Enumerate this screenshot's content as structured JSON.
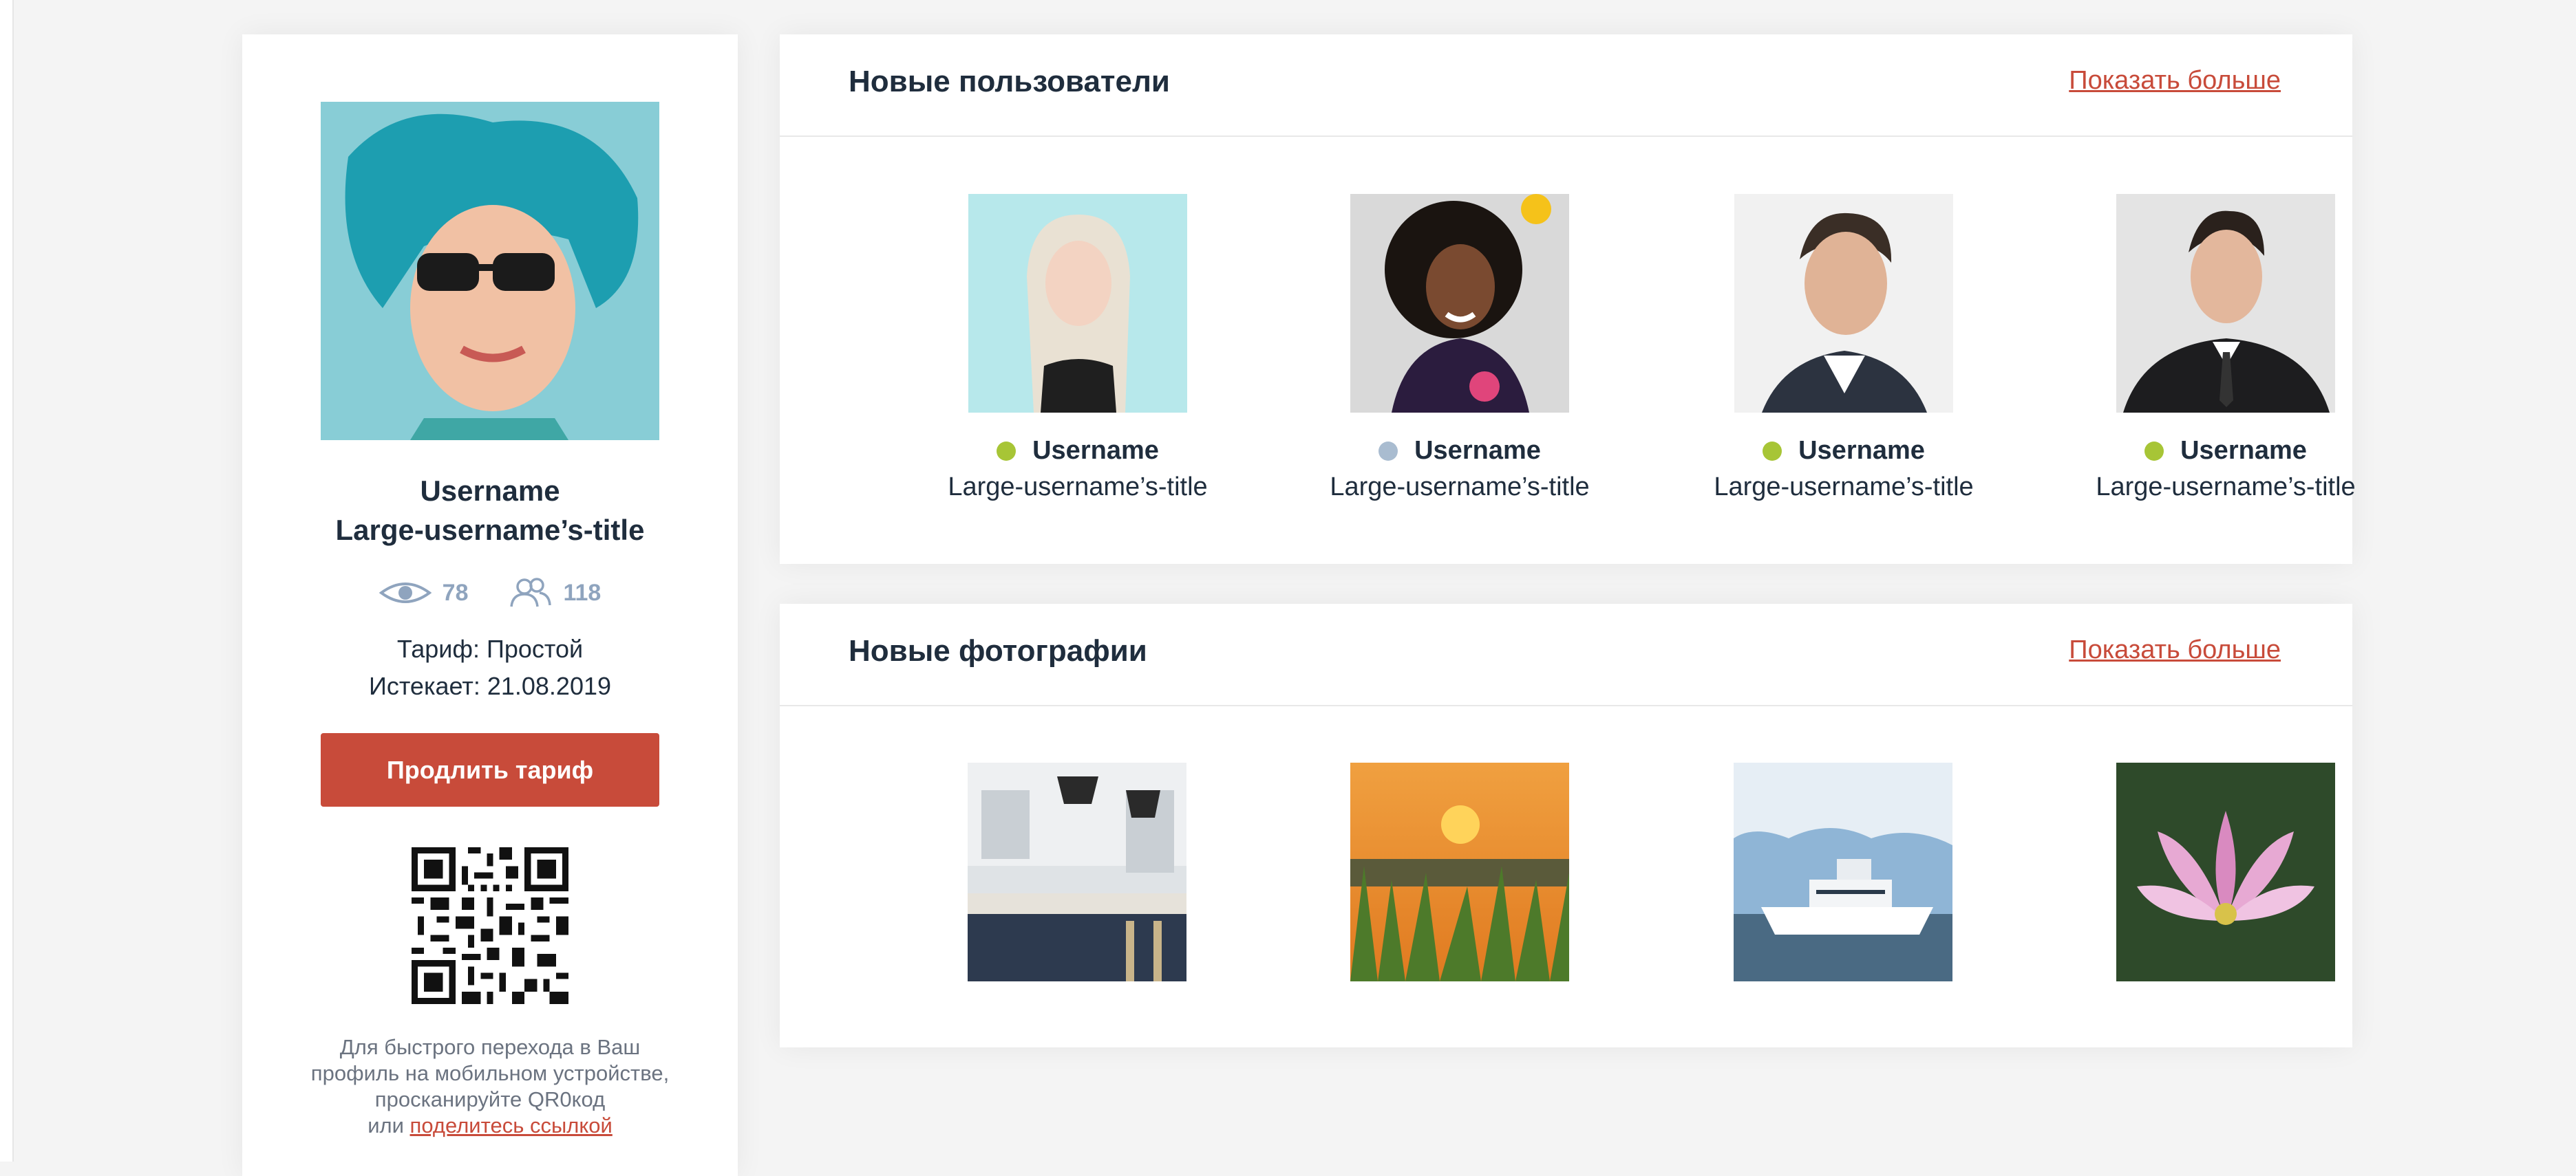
{
  "profile": {
    "username": "Username",
    "title": "Large-username’s-title",
    "views": "78",
    "friends": "118",
    "plan": "Тариф: Простой",
    "expires": "Истекает: 21.08.2019",
    "extend_label": "Продлить тариф",
    "qr_text_line1": "Для быстрого перехода в Ваш",
    "qr_text_line2": "профиль на мобильном устройстве,",
    "qr_text_line3": "просканируйте QR0код",
    "qr_text_or": "или",
    "qr_link": "поделитесь ссылкой"
  },
  "new_users": {
    "title": "Новые пользователи",
    "show_more": "Показать больше",
    "items": [
      {
        "username": "Username",
        "title": "Large-username’s-title",
        "status_color": "#a7c536"
      },
      {
        "username": "Username",
        "title": "Large-username’s-title",
        "status_color": "#a9bcd0"
      },
      {
        "username": "Username",
        "title": "Large-username’s-title",
        "status_color": "#a7c536"
      },
      {
        "username": "Username",
        "title": "Large-username’s-title",
        "status_color": "#a7c536"
      }
    ]
  },
  "new_photos": {
    "title": "Новые фотографии",
    "show_more": "Показать больше"
  },
  "colors": {
    "accent": "#c84b3a",
    "online": "#a7c536",
    "offline": "#a9bcd0",
    "muted": "#8fa4be"
  },
  "icons": {
    "views": "eye-icon",
    "friends": "users-icon"
  }
}
